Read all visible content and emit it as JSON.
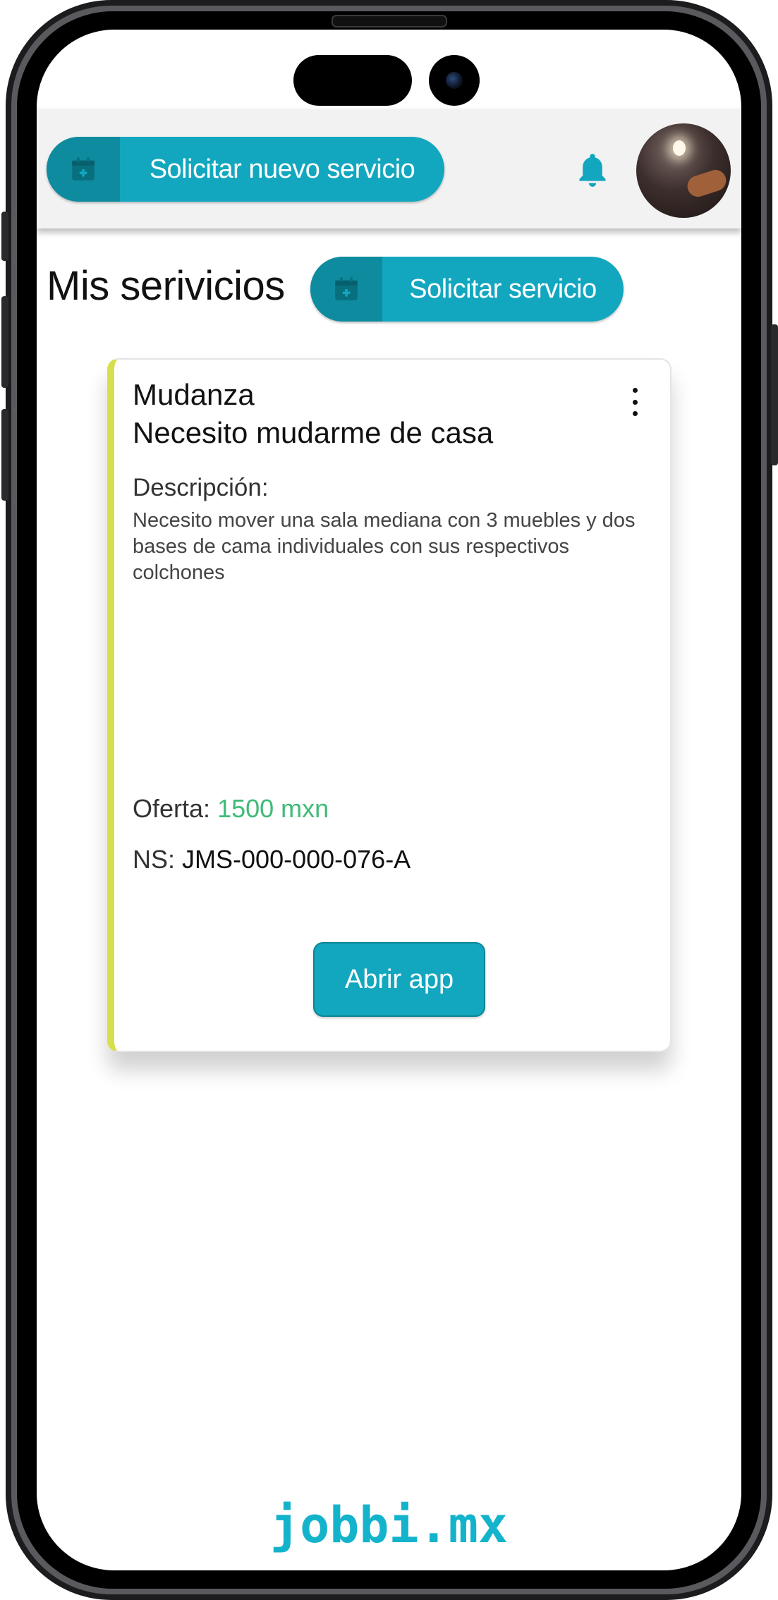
{
  "header": {
    "new_service_button_label": "Solicitar nuevo servicio",
    "notifications_icon": "bell-icon",
    "avatar_icon": "user-avatar"
  },
  "main": {
    "title": "Mis serivicios",
    "request_service_button_label": "Solicitar servicio"
  },
  "service_card": {
    "category": "Mudanza",
    "title": "Necesito mudarme de casa",
    "description_label": "Descripción:",
    "description": "Necesito mover una sala mediana con 3 muebles y dos bases de cama individuales con sus respectivos colchones",
    "offer_label": "Oferta:",
    "offer_value": "1500 mxn",
    "ns_label": "NS:",
    "ns_value": "JMS-000-000-076-A",
    "open_app_button_label": "Abrir app",
    "menu_icon": "more-vertical-icon"
  },
  "footer": {
    "brand": "jobbi.mx"
  },
  "colors": {
    "primary": "#12a7bf",
    "primary_dark": "#0e8b9e",
    "card_accent": "#d7df4c",
    "price_green": "#3fbb78",
    "brand_cyan": "#14b3cc"
  }
}
